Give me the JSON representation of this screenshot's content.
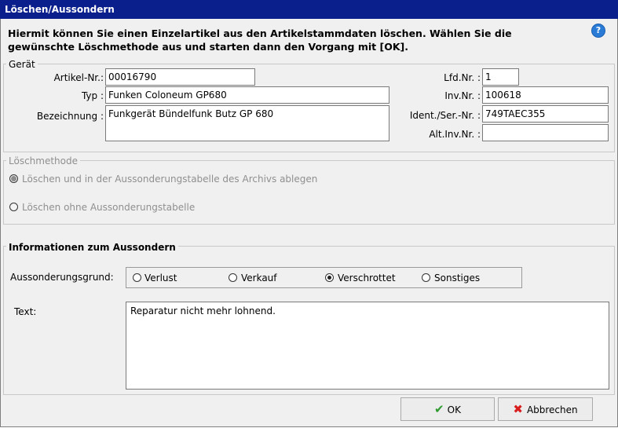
{
  "window": {
    "title": "Löschen/Aussondern"
  },
  "intro": {
    "line1": "Hiermit können Sie einen Einzelartikel aus den Artikelstammdaten löschen. Wählen Sie die",
    "line2": "gewünschte Löschmethode aus und starten dann den Vorgang mit [OK].",
    "help_icon": "?"
  },
  "geraet": {
    "legend": "Gerät",
    "artikel_nr": {
      "label": "Artikel-Nr.:",
      "value": "00016790"
    },
    "typ": {
      "label": "Typ :",
      "value": "Funken Coloneum GP680"
    },
    "bezeichnung": {
      "label": "Bezeichnung :",
      "value": "Funkgerät Bündelfunk Butz GP 680"
    },
    "lfd_nr": {
      "label": "Lfd.Nr. :",
      "value": "1"
    },
    "inv_nr": {
      "label": "Inv.Nr. :",
      "value": "100618"
    },
    "ident_nr": {
      "label": "Ident./Ser.-Nr. :",
      "value": "749TAEC355"
    },
    "alt_inv_nr": {
      "label": "Alt.Inv.Nr. :",
      "value": ""
    }
  },
  "loeschmethode": {
    "legend": "Löschmethode",
    "option1": "Löschen und in der Aussonderungstabelle des Archivs ablegen",
    "option2": "Löschen ohne Aussonderungstabelle",
    "selected": "option1"
  },
  "aussondern": {
    "legend": "Informationen zum Aussondern",
    "grund_label": "Aussonderungsgrund:",
    "options": [
      "Verlust",
      "Verkauf",
      "Verschrottet",
      "Sonstiges"
    ],
    "selected": "Verschrottet",
    "text_label": "Text:",
    "text_value": "Reparatur nicht mehr lohnend."
  },
  "buttons": {
    "ok": "OK",
    "cancel": "Abbrechen"
  },
  "colors": {
    "titlebar": "#0a1e8c",
    "ok_check": "#2e9a2e",
    "cancel_x": "#d81e1e"
  }
}
